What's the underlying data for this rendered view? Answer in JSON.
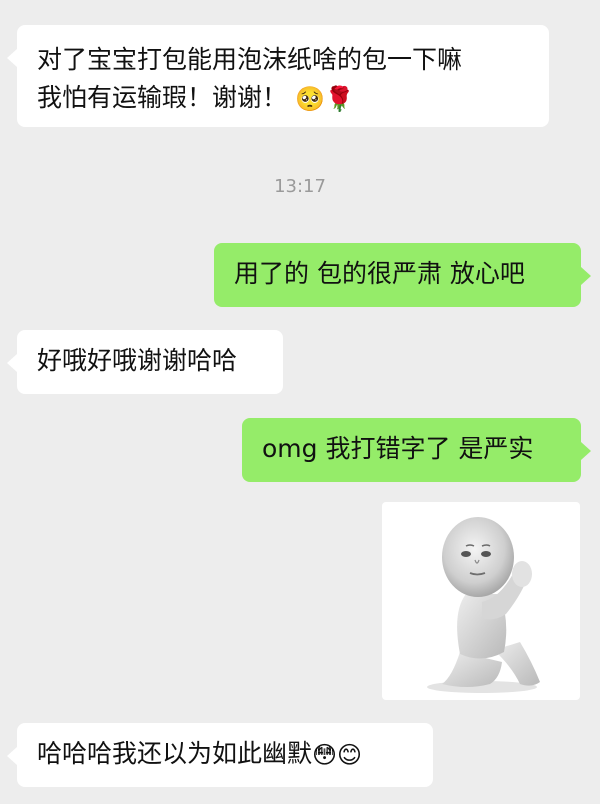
{
  "messages": {
    "m1": {
      "line1": "对了宝宝打包能用泡沫纸啥的包一下嘛",
      "line2": "我怕有运输瑕！谢谢！",
      "emoji1": "🥺",
      "emoji2": "🌹"
    },
    "timestamp": "13:17",
    "m2": {
      "text": "用了的 包的很严肃 放心吧"
    },
    "m3": {
      "text": "好哦好哦谢谢哈哈"
    },
    "m4": {
      "text": "omg 我打错字了 是严实"
    },
    "m5": {
      "text": "哈哈哈我还以为如此幽默",
      "emoji1": "😳",
      "emoji2": "😊"
    }
  },
  "sticker": {
    "icon": "praying-figure-sticker"
  },
  "colors": {
    "background": "#ededed",
    "incoming_bubble": "#ffffff",
    "outgoing_bubble": "#95ec69"
  }
}
